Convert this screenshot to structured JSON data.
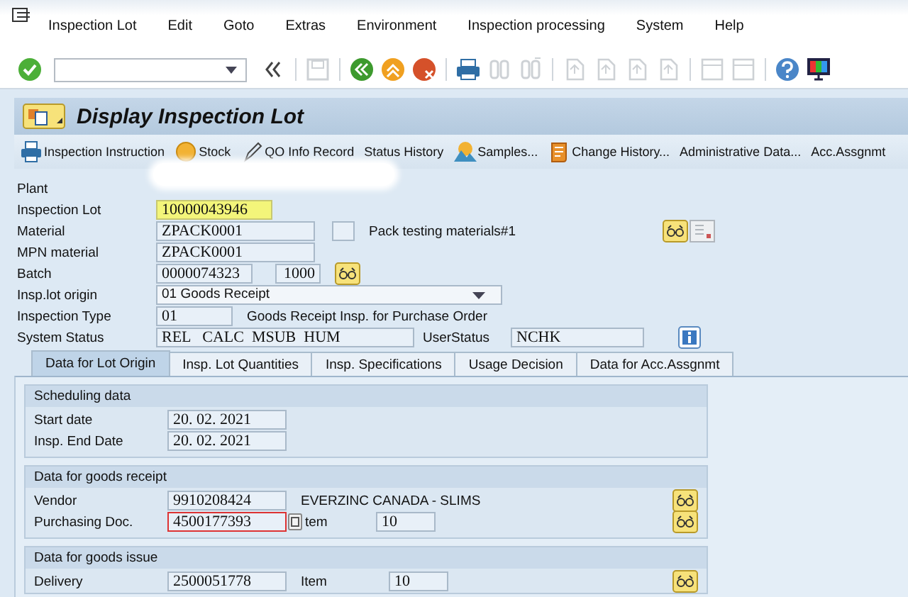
{
  "menu": [
    {
      "label": "Inspection Lot"
    },
    {
      "label": "Edit"
    },
    {
      "label": "Goto"
    },
    {
      "label": "Extras"
    },
    {
      "label": "Environment"
    },
    {
      "label": "Inspection processing"
    },
    {
      "label": "System"
    },
    {
      "label": "Help"
    }
  ],
  "toolbar": [
    {
      "kind": "enter",
      "disabled": false
    },
    {
      "kind": "command"
    },
    {
      "kind": "collapse",
      "disabled": false
    },
    {
      "kind": "save",
      "disabled": true
    },
    {
      "kind": "back",
      "disabled": false
    },
    {
      "kind": "exit",
      "disabled": false
    },
    {
      "kind": "cancel",
      "disabled": false
    },
    {
      "kind": "print",
      "disabled": false
    },
    {
      "kind": "find",
      "disabled": true
    },
    {
      "kind": "find-next",
      "disabled": true
    },
    {
      "kind": "page",
      "disabled": true
    },
    {
      "kind": "page",
      "disabled": true
    },
    {
      "kind": "page",
      "disabled": true
    },
    {
      "kind": "page",
      "disabled": true
    },
    {
      "kind": "window",
      "disabled": true
    },
    {
      "kind": "window",
      "disabled": true
    },
    {
      "kind": "help",
      "disabled": false
    },
    {
      "kind": "monitor",
      "disabled": false
    }
  ],
  "title": "Display Inspection Lot",
  "app_toolbar": [
    {
      "kind": "printer",
      "label": "Inspection Instruction"
    },
    {
      "kind": "coin",
      "label": "Stock"
    },
    {
      "kind": "pencil",
      "label": "QO Info Record"
    },
    {
      "kind": "plain",
      "label": "Status History"
    },
    {
      "kind": "mountain",
      "label": "Samples..."
    },
    {
      "kind": "scroll",
      "label": "Change History..."
    },
    {
      "kind": "plain",
      "label": "Administrative Data..."
    },
    {
      "kind": "plain",
      "label": "Acc.Assgnmt"
    }
  ],
  "header": {
    "plant": {
      "label": "Plant"
    },
    "inspection_lot": {
      "label": "Inspection Lot",
      "value": "10000043946",
      "highlighted": true
    },
    "material": {
      "label": "Material",
      "value": "ZPACK0001",
      "checked": false,
      "description": "Pack testing materials#1"
    },
    "mpn_material": {
      "label": "MPN material",
      "value": "ZPACK0001"
    },
    "batch": {
      "label": "Batch",
      "value": "0000074323",
      "plant": "1000"
    },
    "origin": {
      "label": "Insp.lot origin",
      "value": "01 Goods Receipt"
    },
    "inspection_type": {
      "label": "Inspection Type",
      "value": "01",
      "description": "Goods Receipt Insp. for Purchase Order"
    },
    "system_status": {
      "label": "System Status",
      "value": "REL   CALC  MSUB  HUM",
      "user_status_label": "UserStatus",
      "user_status": "NCHK"
    }
  },
  "tabs": [
    {
      "label": "Data for Lot Origin",
      "selected": true
    },
    {
      "label": "Insp. Lot Quantities",
      "selected": false
    },
    {
      "label": "Insp. Specifications",
      "selected": false
    },
    {
      "label": "Usage Decision",
      "selected": false
    },
    {
      "label": "Data for Acc.Assgnmt",
      "selected": false
    }
  ],
  "scheduling": {
    "title": "Scheduling data",
    "rows": [
      {
        "label": "Start date",
        "value": "20. 02. 2021"
      },
      {
        "label": "Insp. End Date",
        "value": "20. 02. 2021"
      }
    ]
  },
  "goods_receipt": {
    "title": "Data for goods receipt",
    "vendor": {
      "label": "Vendor",
      "value": "9910208424",
      "name": "EVERZINC CANADA - SLIMS"
    },
    "purchasing_doc": {
      "label": "Purchasing Doc.",
      "value": "4500177393",
      "focused": true,
      "item_label": "tem",
      "item": "10"
    }
  },
  "goods_issue": {
    "title": "Data for goods issue",
    "delivery": {
      "label": "Delivery",
      "value": "2500051778",
      "item_label": "Item",
      "item": "10"
    }
  }
}
